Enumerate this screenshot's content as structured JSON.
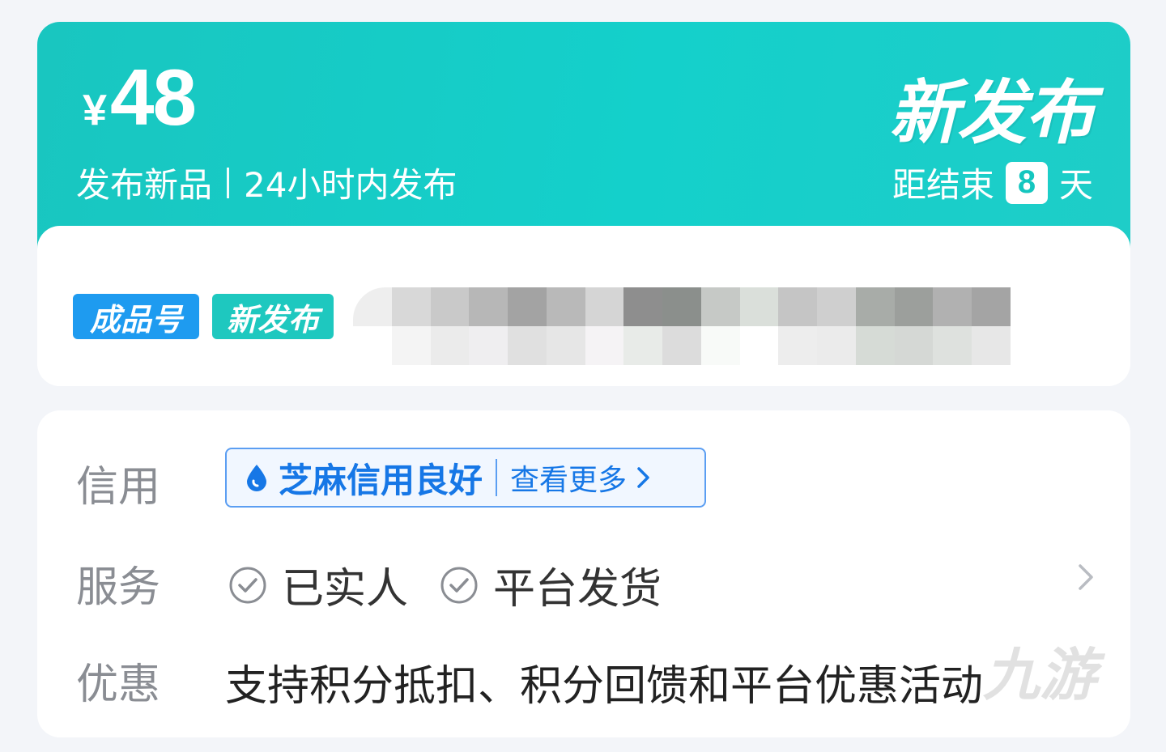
{
  "hero": {
    "currency": "¥",
    "price": "48",
    "subtitle_left": "发布新品",
    "subtitle_right": "24小时内发布",
    "brand": "新发布",
    "countdown_prefix": "距结束",
    "countdown_days": "8",
    "countdown_suffix": "天"
  },
  "tags": {
    "type": "成品号",
    "status": "新发布"
  },
  "details": {
    "credit_label": "信用",
    "credit_value": "芝麻信用良好",
    "credit_more": "查看更多",
    "service_label": "服务",
    "services": [
      "已实人",
      "平台发货"
    ],
    "promo_label": "优惠",
    "promo_text": "支持积分抵扣、积分回馈和平台优惠活动"
  },
  "watermark": "九游",
  "colors": {
    "hero_teal": "#14d0cb",
    "tag_blue": "#1e9bf0",
    "tag_teal": "#1ec8bf",
    "credit_blue": "#1677e6"
  }
}
